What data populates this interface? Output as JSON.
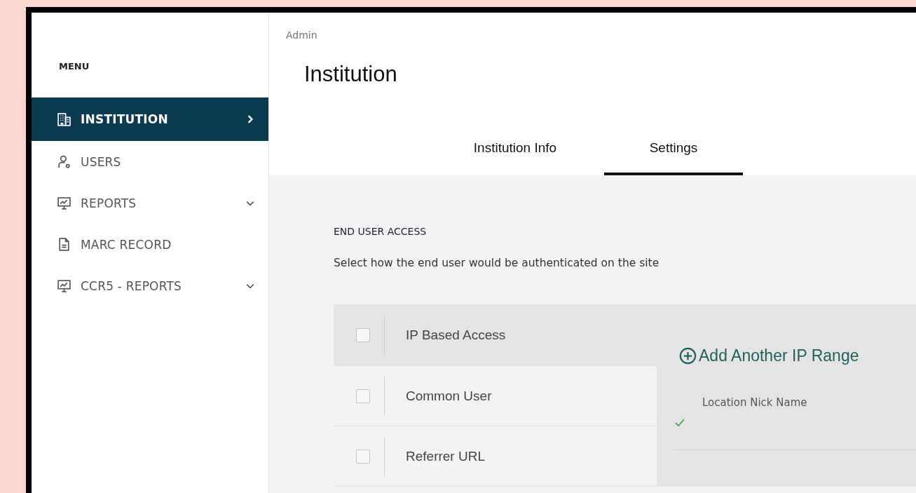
{
  "sidebar": {
    "heading": "MENU",
    "items": [
      {
        "label": "INSTITUTION",
        "kind": "building",
        "selected": true,
        "expandable": false
      },
      {
        "label": "USERS",
        "kind": "user",
        "selected": false,
        "expandable": false
      },
      {
        "label": "REPORTS",
        "kind": "presentation",
        "selected": false,
        "expandable": true
      },
      {
        "label": "MARC RECORD",
        "kind": "document",
        "selected": false,
        "expandable": false
      },
      {
        "label": "CCR5 - REPORTS",
        "kind": "presentation",
        "selected": false,
        "expandable": true
      }
    ]
  },
  "breadcrumb": "Admin",
  "title": "Institution",
  "tabs": [
    {
      "label": "Institution Info",
      "selected": false
    },
    {
      "label": "Settings",
      "selected": true
    }
  ],
  "section": {
    "heading": "END USER ACCESS",
    "description": "Select how the end user would be authenticated on the site",
    "options": [
      {
        "label": "IP Based Access",
        "checked": false,
        "selected": true
      },
      {
        "label": "Common User",
        "checked": false,
        "selected": false
      },
      {
        "label": "Referrer URL",
        "checked": false,
        "selected": false
      }
    ],
    "add_button": "Add Another IP Range",
    "field_label": "Location Nick Name",
    "field_valid": true
  }
}
